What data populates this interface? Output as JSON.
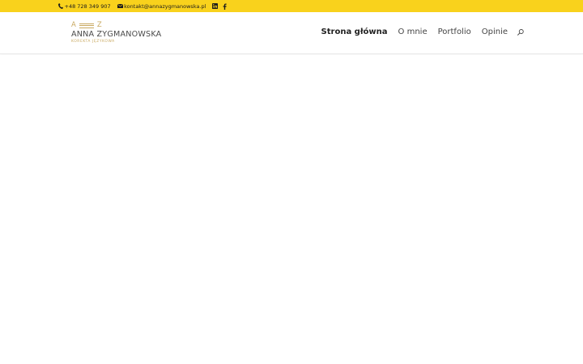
{
  "topbar": {
    "phone": "+48 728 349 907",
    "email": "kontakt@annazygmanowska.pl",
    "social": [
      "linkedin-icon",
      "facebook-icon"
    ],
    "background": "#f9d21c"
  },
  "logo": {
    "mark_left": "A",
    "mark_right": "Z",
    "name": "ANNA ZYGMANOWSKA",
    "tagline": "KOREKTA JĘZYKOWA",
    "accent": "#c9a961"
  },
  "nav": {
    "items": [
      {
        "label": "Strona główna",
        "active": true
      },
      {
        "label": "O mnie",
        "active": false
      },
      {
        "label": "Portfolio",
        "active": false
      },
      {
        "label": "Opinie",
        "active": false
      }
    ],
    "search_icon": "search-icon"
  }
}
